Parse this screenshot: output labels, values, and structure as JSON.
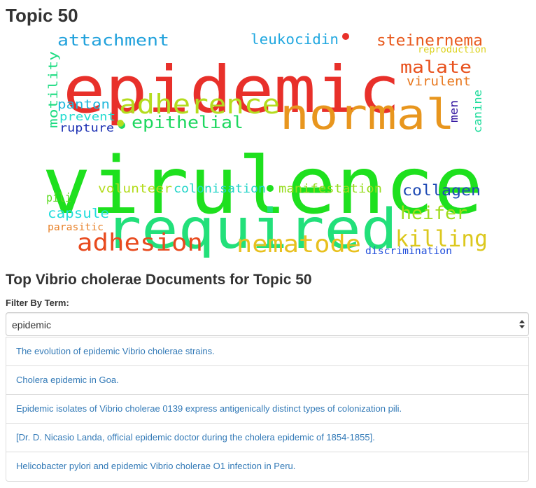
{
  "page": {
    "title": "Topic 50",
    "docs_heading": "Top Vibrio cholerae Documents for Topic 50",
    "filter_label": "Filter By Term:"
  },
  "filter": {
    "selected": "epidemic"
  },
  "documents": [
    "The evolution of epidemic Vibrio cholerae strains.",
    "Cholera epidemic in Goa.",
    "Epidemic isolates of Vibrio cholerae 0139 express antigenically distinct types of colonization pili.",
    "[Dr. D. Nicasio Landa, official epidemic doctor during the cholera epidemic of 1854-1855].",
    "Helicobacter pylori and epidemic Vibrio cholerae O1 infection in Peru."
  ],
  "colors": {
    "link": "#337ab7",
    "heading": "#333333"
  },
  "wordcloud": {
    "words": [
      {
        "text": "epidemic",
        "color": "#e8302a"
      },
      {
        "text": "virulence",
        "color": "#1ee01e"
      },
      {
        "text": "required",
        "color": "#22e07a"
      },
      {
        "text": "normal",
        "color": "#e8961e"
      },
      {
        "text": "adherence",
        "color": "#b4dc1e"
      },
      {
        "text": "adhesion",
        "color": "#e84a1e"
      },
      {
        "text": "nematode",
        "color": "#e8c01e"
      },
      {
        "text": "killing",
        "color": "#dcc81e"
      },
      {
        "text": "heifer",
        "color": "#a0dc1e"
      },
      {
        "text": "collagen",
        "color": "#1e4ab4"
      },
      {
        "text": "attachment",
        "color": "#22a2dc"
      },
      {
        "text": "leukocidin",
        "color": "#22a8e0"
      },
      {
        "text": "steinernema",
        "color": "#e85a1e"
      },
      {
        "text": "malate",
        "color": "#e8521e"
      },
      {
        "text": "virulent",
        "color": "#e8781e"
      },
      {
        "text": "reproduction",
        "color": "#dcd21e"
      },
      {
        "text": "epithelial",
        "color": "#1ed860"
      },
      {
        "text": "panton",
        "color": "#22b8dc"
      },
      {
        "text": "prevent",
        "color": "#22dcd0"
      },
      {
        "text": "rupture",
        "color": "#1e32b4"
      },
      {
        "text": "motility",
        "color": "#1edc82"
      },
      {
        "text": "men",
        "color": "#3214a0"
      },
      {
        "text": "canine",
        "color": "#1edc9c"
      },
      {
        "text": "pili",
        "color": "#5adc1e"
      },
      {
        "text": "volunteer",
        "color": "#b4dc1e"
      },
      {
        "text": "colonisation",
        "color": "#22d4c8"
      },
      {
        "text": "manifestation",
        "color": "#96dc1e"
      },
      {
        "text": "capsule",
        "color": "#22dcdc"
      },
      {
        "text": "parasitic",
        "color": "#e8822a"
      },
      {
        "text": "discrimination",
        "color": "#2250dc"
      }
    ]
  }
}
